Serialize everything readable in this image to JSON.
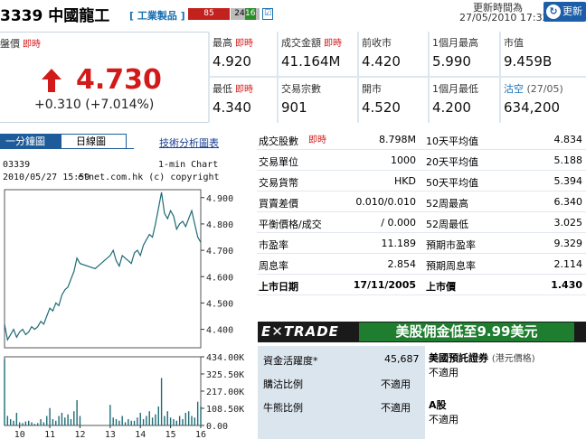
{
  "header": {
    "code_name": "3339 中國龍工",
    "industry": "[ 工業製品 ]",
    "red_count": "85",
    "gray_count": "24",
    "green_count": "16",
    "small_icon": "☑",
    "update_label": "更新時間為",
    "update_time": "27/05/2010 17:32",
    "refresh_label": "更新",
    "refresh_icon": "↻"
  },
  "quote": {
    "prev_label": "盤價",
    "live": "即時",
    "price": "4.730",
    "change": "+0.310 (+7.014%)",
    "high_label": "最高",
    "high_live": "即時",
    "high": "4.920",
    "low_label": "最低",
    "low_live": "即時",
    "low": "4.340",
    "turnover_label": "成交金額",
    "turnover_live": "即時",
    "turnover": "41.164M",
    "trades_label": "交易宗數",
    "trades": "901",
    "prevclose_label": "前收市",
    "prevclose": "4.420",
    "open_label": "開市",
    "open": "4.520",
    "m1high_label": "1個月最高",
    "m1high": "5.990",
    "m1low_label": "1個月最低",
    "m1low": "4.200",
    "mktcap_label": "市值",
    "mktcap": "9.459B",
    "short_label": "沽空",
    "short_date": "(27/05)",
    "short": "634,200"
  },
  "chart_tabs": {
    "tab1": "一分鐘圖",
    "tab2": "日線圖",
    "tech": "技術分析圖表"
  },
  "chart_info": {
    "code": "03339",
    "type": "1-min Chart",
    "datetime": "2010/05/27 15:59",
    "copyright": "etnet.com.hk (c) copyright"
  },
  "chart_data": [
    {
      "type": "line",
      "y_ticks": [
        "4.900",
        "4.800",
        "4.700",
        "4.600",
        "4.500",
        "4.400"
      ],
      "ylim": [
        4.33,
        4.93
      ],
      "x_ticks": [
        "10",
        "11",
        "12",
        "13",
        "14",
        "15",
        "16"
      ],
      "x": [
        9.5,
        9.6,
        9.7,
        9.8,
        9.9,
        10.0,
        10.1,
        10.2,
        10.3,
        10.4,
        10.5,
        10.6,
        10.7,
        10.8,
        10.9,
        11.0,
        11.1,
        11.2,
        11.3,
        11.4,
        11.5,
        11.6,
        11.7,
        11.8,
        11.9,
        12.0,
        12.5,
        13.0,
        13.1,
        13.2,
        13.3,
        13.4,
        13.5,
        13.6,
        13.7,
        13.8,
        13.9,
        14.0,
        14.1,
        14.2,
        14.3,
        14.4,
        14.5,
        14.6,
        14.7,
        14.8,
        14.9,
        15.0,
        15.1,
        15.2,
        15.3,
        15.4,
        15.5,
        15.6,
        15.7,
        15.8,
        15.9,
        16.0
      ],
      "y": [
        4.42,
        4.36,
        4.38,
        4.4,
        4.37,
        4.39,
        4.4,
        4.38,
        4.39,
        4.41,
        4.4,
        4.41,
        4.43,
        4.42,
        4.45,
        4.48,
        4.47,
        4.5,
        4.49,
        4.53,
        4.55,
        4.56,
        4.59,
        4.62,
        4.67,
        4.65,
        4.63,
        4.68,
        4.7,
        4.66,
        4.64,
        4.68,
        4.67,
        4.66,
        4.65,
        4.69,
        4.7,
        4.68,
        4.72,
        4.74,
        4.76,
        4.75,
        4.8,
        4.86,
        4.92,
        4.84,
        4.82,
        4.85,
        4.83,
        4.78,
        4.8,
        4.81,
        4.79,
        4.82,
        4.85,
        4.8,
        4.75,
        4.73
      ]
    },
    {
      "type": "bar",
      "y_ticks": [
        "434.00K",
        "325.50K",
        "217.00K",
        "108.50K",
        "0.00"
      ],
      "ylim": [
        0,
        434000
      ],
      "x": [
        9.5,
        9.6,
        9.7,
        9.8,
        9.9,
        10.0,
        10.1,
        10.2,
        10.3,
        10.4,
        10.5,
        10.6,
        10.7,
        10.8,
        10.9,
        11.0,
        11.1,
        11.2,
        11.3,
        11.4,
        11.5,
        11.6,
        11.7,
        11.8,
        11.9,
        12.0,
        13.0,
        13.1,
        13.2,
        13.3,
        13.4,
        13.5,
        13.6,
        13.7,
        13.8,
        13.9,
        14.0,
        14.1,
        14.2,
        14.3,
        14.4,
        14.5,
        14.6,
        14.7,
        14.8,
        14.9,
        15.0,
        15.1,
        15.2,
        15.3,
        15.4,
        15.5,
        15.6,
        15.7,
        15.8,
        15.9,
        16.0
      ],
      "values": [
        420000,
        60000,
        40000,
        30000,
        80000,
        20000,
        15000,
        25000,
        30000,
        20000,
        10000,
        15000,
        40000,
        20000,
        60000,
        110000,
        40000,
        30000,
        60000,
        80000,
        50000,
        70000,
        40000,
        90000,
        160000,
        60000,
        130000,
        50000,
        40000,
        30000,
        60000,
        20000,
        40000,
        30000,
        30000,
        50000,
        80000,
        40000,
        60000,
        90000,
        50000,
        70000,
        120000,
        300000,
        60000,
        90000,
        50000,
        40000,
        30000,
        60000,
        40000,
        80000,
        90000,
        60000,
        50000,
        150000,
        120000
      ]
    }
  ],
  "stats": [
    {
      "l1": "成交股數",
      "l1live": "即時",
      "v1": "8.798M",
      "l2": "10天平均值",
      "v2": "4.834"
    },
    {
      "l1": "交易單位",
      "v1": "1000",
      "l2": "20天平均值",
      "v2": "5.188"
    },
    {
      "l1": "交易貨幣",
      "v1": "HKD",
      "l2": "50天平均值",
      "v2": "5.394"
    },
    {
      "l1": "買賣差價",
      "v1": "0.010/0.010",
      "l2": "52周最高",
      "v2": "6.340"
    },
    {
      "l1": "平衡價格/成交",
      "v1": "/ 0.000",
      "l2": "52周最低",
      "v2": "3.025"
    },
    {
      "l1": "市盈率",
      "v1": "11.189",
      "l2": "預期市盈率",
      "v2": "9.329"
    },
    {
      "l1": "周息率",
      "v1": "2.854",
      "l2": "預期周息率",
      "v2": "2.114"
    },
    {
      "l1": "上市日期",
      "v1": "17/11/2005",
      "l2": "上市價",
      "v2": "1.430",
      "bold": true
    }
  ],
  "banner": {
    "etrade": "E✕TRADE",
    "ad": "美股佣金低至9.99美元"
  },
  "bottom": {
    "activity_label": "資金活躍度*",
    "activity": "45,687",
    "buy_label": "購沽比例",
    "buy": "不適用",
    "bull_label": "牛熊比例",
    "bull": "不適用",
    "adr_label": "美國預託證券",
    "adr_sub": "(港元價格)",
    "adr": "不適用",
    "a_label": "A股",
    "a": "不適用"
  }
}
